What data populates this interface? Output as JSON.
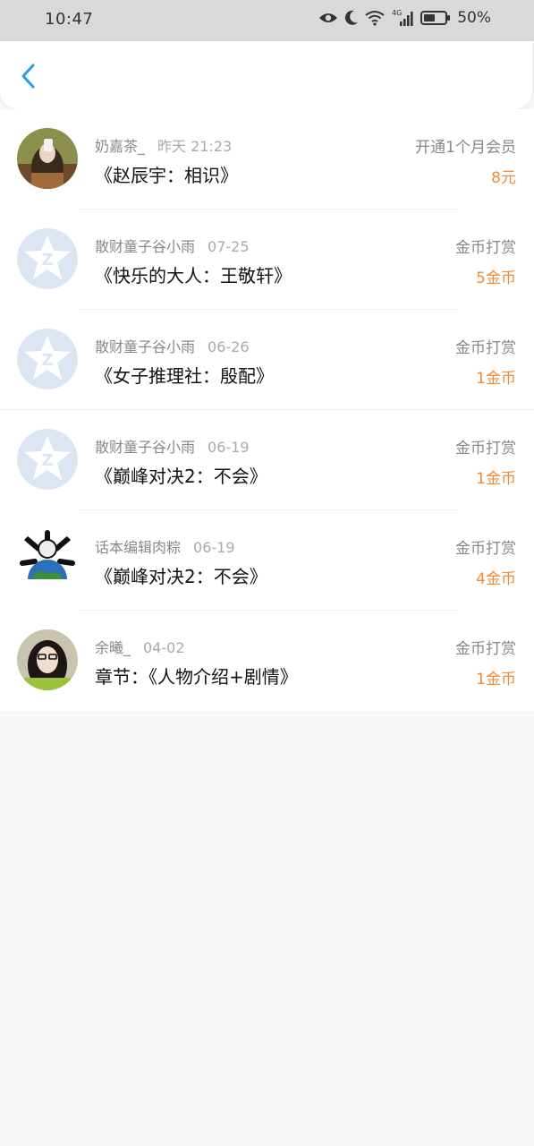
{
  "status_bar": {
    "time": "10:47",
    "network": "4G",
    "battery": "50%"
  },
  "header": {
    "back_icon": "chevron-left-icon",
    "accent_color": "#2b9be8"
  },
  "colors": {
    "amount": "#ee8a3a",
    "muted_text": "#888888"
  },
  "items": [
    {
      "name": "奶嘉茶_",
      "date": "昨天 21:23",
      "title": "《赵辰宇：相识》",
      "type": "开通1个月会员",
      "amount": "8元",
      "avatar": "photo-avatar"
    },
    {
      "name": "散财童子谷小雨",
      "date": "07-25",
      "title": "《快乐的大人：王敬轩》",
      "type": "金币打赏",
      "amount": "5金币",
      "avatar": "default-qq-avatar"
    },
    {
      "name": "散财童子谷小雨",
      "date": "06-26",
      "title": "《女子推理社：殷配》",
      "type": "金币打赏",
      "amount": "1金币",
      "avatar": "default-qq-avatar"
    },
    {
      "name": "散财童子谷小雨",
      "date": "06-19",
      "title": "《巅峰对决2：不会》",
      "type": "金币打赏",
      "amount": "1金币",
      "avatar": "default-qq-avatar"
    },
    {
      "name": "话本编辑肉粽",
      "date": "06-19",
      "title": "《巅峰对决2：不会》",
      "type": "金币打赏",
      "amount": "4金币",
      "avatar": "globe-avatar"
    },
    {
      "name": "余曦_",
      "date": "04-02",
      "title": "章节：《人物介绍+剧情》",
      "type": "金币打赏",
      "amount": "1金币",
      "avatar": "photo-avatar"
    }
  ]
}
